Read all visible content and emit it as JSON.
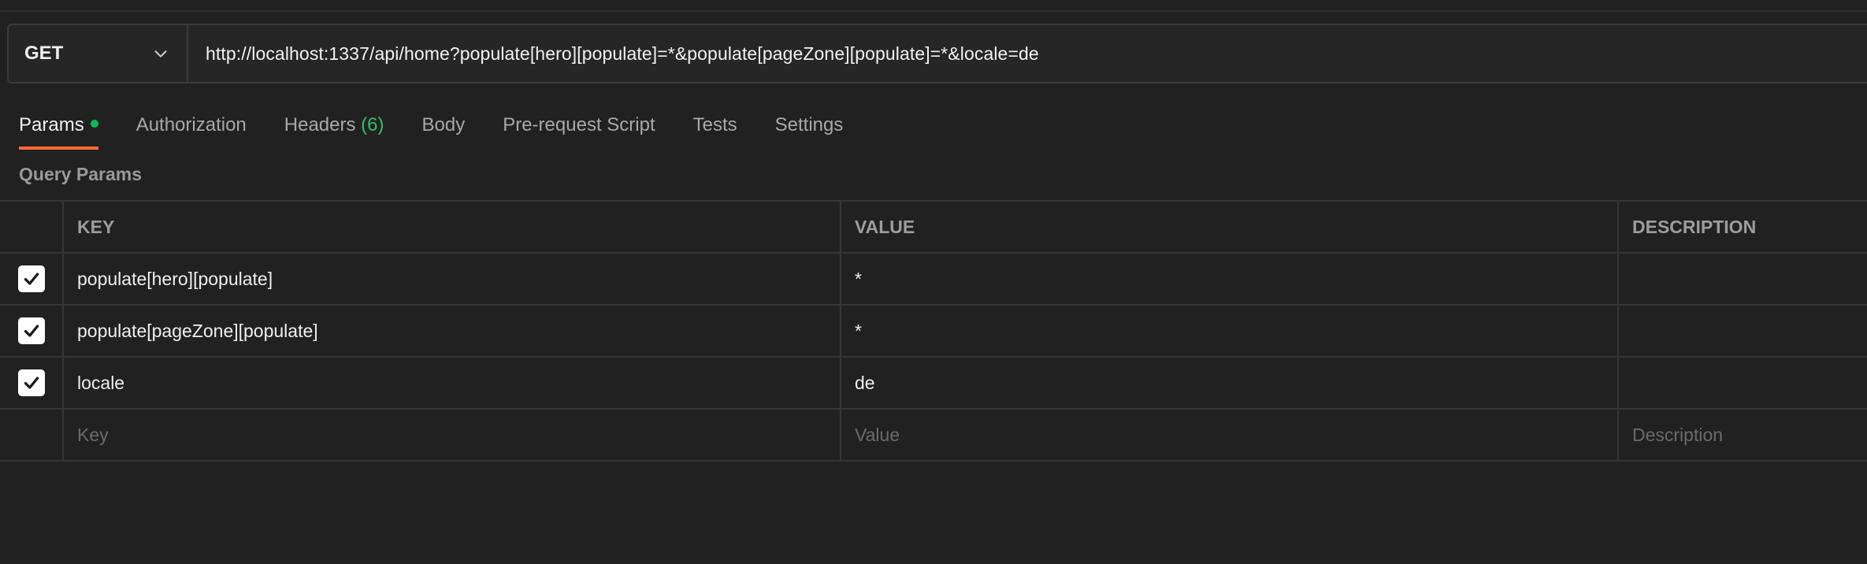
{
  "request": {
    "method": "GET",
    "url": "http://localhost:1337/api/home?populate[hero][populate]=*&populate[pageZone][populate]=*&locale=de"
  },
  "tabs": [
    {
      "label": "Params"
    },
    {
      "label": "Authorization"
    },
    {
      "label": "Headers",
      "count": "(6)"
    },
    {
      "label": "Body"
    },
    {
      "label": "Pre-request Script"
    },
    {
      "label": "Tests"
    },
    {
      "label": "Settings"
    }
  ],
  "query_params": {
    "title": "Query Params",
    "headers": {
      "key": "KEY",
      "value": "VALUE",
      "description": "DESCRIPTION"
    },
    "rows": [
      {
        "key": "populate[hero][populate]",
        "value": "*",
        "checked": true
      },
      {
        "key": "populate[pageZone][populate]",
        "value": "*",
        "checked": true
      },
      {
        "key": "locale",
        "value": "de",
        "checked": true
      }
    ],
    "placeholders": {
      "key": "Key",
      "value": "Value",
      "description": "Description"
    }
  },
  "colors": {
    "background": "#212121",
    "active_tab_underline": "#ff6c37",
    "params_dot": "#0cbb52",
    "header_count": "#2ec06a"
  }
}
